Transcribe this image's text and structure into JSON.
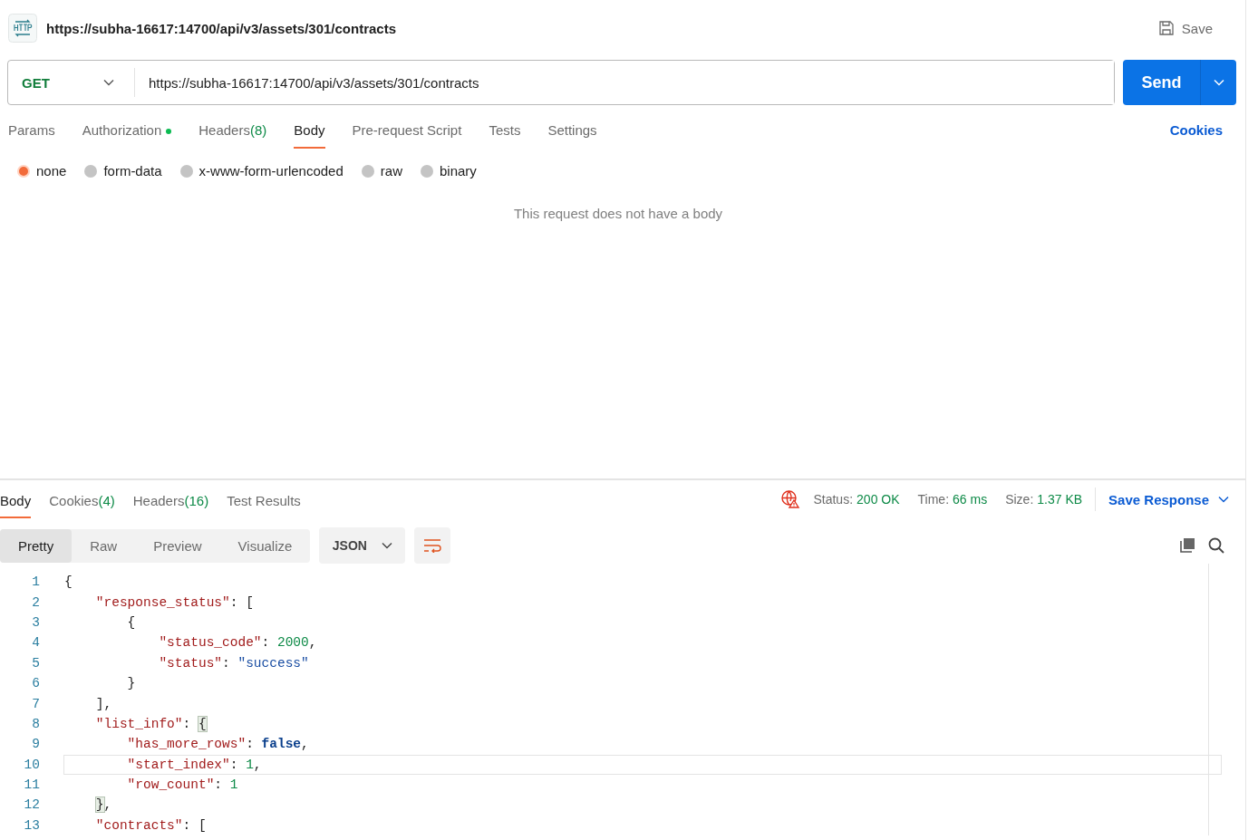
{
  "request": {
    "title": "https://subha-16617:14700/api/v3/assets/301/contracts",
    "save": "Save",
    "method": "GET",
    "url": "https://subha-16617:14700/api/v3/assets/301/contracts",
    "send": "Send"
  },
  "request_tabs": [
    {
      "label": "Params",
      "dot": false,
      "selected": false
    },
    {
      "label": "Authorization",
      "dot": true,
      "selected": false
    },
    {
      "label": "Headers",
      "count": "(8)",
      "dot": false,
      "selected": false
    },
    {
      "label": "Body",
      "dot": false,
      "selected": true
    },
    {
      "label": "Pre-request Script",
      "dot": false,
      "selected": false
    },
    {
      "label": "Tests",
      "dot": false,
      "selected": false
    },
    {
      "label": "Settings",
      "dot": false,
      "selected": false
    }
  ],
  "cookies_link": "Cookies",
  "body_types": [
    {
      "label": "none",
      "selected": true
    },
    {
      "label": "form-data",
      "selected": false
    },
    {
      "label": "x-www-form-urlencoded",
      "selected": false
    },
    {
      "label": "raw",
      "selected": false
    },
    {
      "label": "binary",
      "selected": false
    }
  ],
  "empty_body_message": "This request does not have a body",
  "response_tabs": [
    {
      "label": "Body",
      "selected": true
    },
    {
      "label": "Cookies",
      "count": "(4)",
      "selected": false
    },
    {
      "label": "Headers",
      "count": "(16)",
      "selected": false
    },
    {
      "label": "Test Results",
      "selected": false
    }
  ],
  "response_meta": {
    "status_label": "Status:",
    "status": "200 OK",
    "time_label": "Time:",
    "time": "66 ms",
    "size_label": "Size:",
    "size": "1.37 KB",
    "save_response": "Save Response"
  },
  "view_modes": [
    {
      "label": "Pretty",
      "selected": true
    },
    {
      "label": "Raw",
      "selected": false
    },
    {
      "label": "Preview",
      "selected": false
    },
    {
      "label": "Visualize",
      "selected": false
    }
  ],
  "format": "JSON",
  "code_lines": [
    {
      "number": "1",
      "selected": false,
      "tokens": [
        {
          "kind": "punct",
          "text": "{"
        }
      ]
    },
    {
      "number": "2",
      "selected": false,
      "tokens": [
        {
          "kind": "key",
          "text": "    \"response_status\""
        },
        {
          "kind": "punct",
          "text": ": ["
        }
      ]
    },
    {
      "number": "3",
      "selected": false,
      "tokens": [
        {
          "kind": "punct",
          "text": "        {"
        }
      ]
    },
    {
      "number": "4",
      "selected": false,
      "tokens": [
        {
          "kind": "key",
          "text": "            \"status_code\""
        },
        {
          "kind": "punct",
          "text": ": "
        },
        {
          "kind": "number",
          "text": "2000"
        },
        {
          "kind": "punct",
          "text": ","
        }
      ]
    },
    {
      "number": "5",
      "selected": false,
      "tokens": [
        {
          "kind": "key",
          "text": "            \"status\""
        },
        {
          "kind": "punct",
          "text": ": "
        },
        {
          "kind": "string",
          "text": "\"success\""
        }
      ]
    },
    {
      "number": "6",
      "selected": false,
      "tokens": [
        {
          "kind": "punct",
          "text": "        }"
        }
      ]
    },
    {
      "number": "7",
      "selected": false,
      "tokens": [
        {
          "kind": "punct",
          "text": "    ],"
        }
      ]
    },
    {
      "number": "8",
      "selected": false,
      "tokens": [
        {
          "kind": "key",
          "text": "    \"list_info\""
        },
        {
          "kind": "punct",
          "text": ": "
        },
        {
          "kind": "match",
          "text": "{"
        }
      ]
    },
    {
      "number": "9",
      "selected": false,
      "tokens": [
        {
          "kind": "key",
          "text": "        \"has_more_rows\""
        },
        {
          "kind": "punct",
          "text": ": "
        },
        {
          "kind": "bool",
          "text": "false"
        },
        {
          "kind": "punct",
          "text": ","
        }
      ]
    },
    {
      "number": "10",
      "selected": true,
      "tokens": [
        {
          "kind": "key",
          "text": "        \"start_index\""
        },
        {
          "kind": "punct",
          "text": ": "
        },
        {
          "kind": "number",
          "text": "1"
        },
        {
          "kind": "punct",
          "text": ","
        }
      ]
    },
    {
      "number": "11",
      "selected": false,
      "tokens": [
        {
          "kind": "key",
          "text": "        \"row_count\""
        },
        {
          "kind": "punct",
          "text": ": "
        },
        {
          "kind": "number",
          "text": "1"
        }
      ]
    },
    {
      "number": "12",
      "selected": false,
      "tokens": [
        {
          "kind": "match",
          "text": "    }"
        },
        {
          "kind": "punct",
          "text": ","
        }
      ]
    },
    {
      "number": "13",
      "selected": false,
      "tokens": [
        {
          "kind": "key",
          "text": "    \"contracts\""
        },
        {
          "kind": "punct",
          "text": ": ["
        }
      ]
    }
  ]
}
